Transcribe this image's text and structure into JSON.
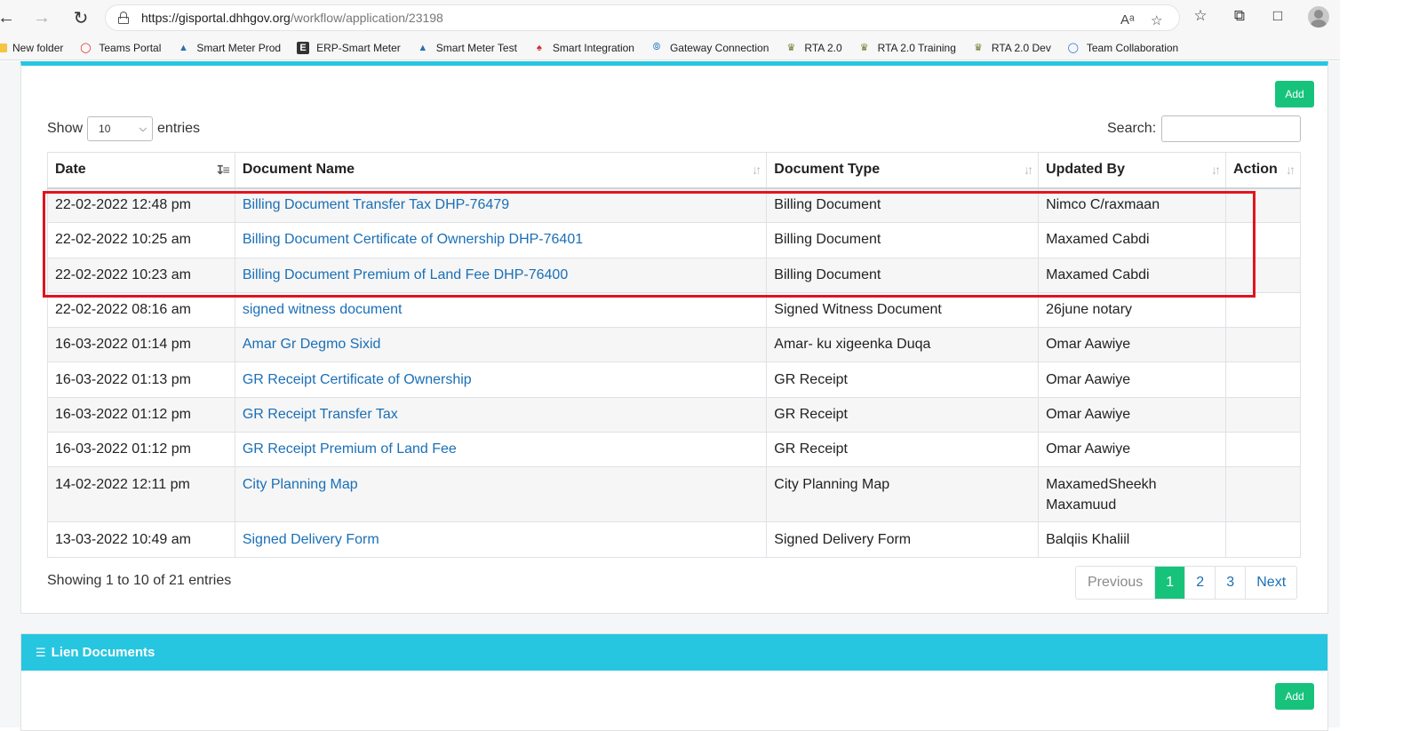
{
  "browser": {
    "url_host": "https://gisportal.dhhgov.org",
    "url_path": "/workflow/application/23198",
    "bookmarks": [
      {
        "label": "New folder",
        "icon": "folder-icon"
      },
      {
        "label": "Teams Portal",
        "icon": "teams-portal-icon"
      },
      {
        "label": "Smart Meter Prod",
        "icon": "water-drop-icon"
      },
      {
        "label": "ERP-Smart Meter",
        "icon": "e-letter-icon"
      },
      {
        "label": "Smart Meter Test",
        "icon": "water-drop-icon"
      },
      {
        "label": "Smart Integration",
        "icon": "crown-icon"
      },
      {
        "label": "Gateway Connection",
        "icon": "gateway-icon"
      },
      {
        "label": "RTA 2.0",
        "icon": "crest-icon"
      },
      {
        "label": "RTA 2.0 Training",
        "icon": "crest-icon"
      },
      {
        "label": "RTA 2.0 Dev",
        "icon": "crest-icon"
      },
      {
        "label": "Team Collaboration",
        "icon": "collab-icon"
      }
    ]
  },
  "documents": {
    "add_label": "Add",
    "show_label": "Show",
    "entries_label": "entries",
    "page_length": "10",
    "search_label": "Search:",
    "columns": [
      "Date",
      "Document Name",
      "Document Type",
      "Updated By",
      "Action"
    ],
    "rows": [
      {
        "date": "22-02-2022 12:48 pm",
        "name": "Billing Document Transfer Tax DHP-76479",
        "type": "Billing Document",
        "updated_by": "Nimco C/raxmaan"
      },
      {
        "date": "22-02-2022 10:25 am",
        "name": "Billing Document Certificate of Ownership DHP-76401",
        "type": "Billing Document",
        "updated_by": "Maxamed Cabdi"
      },
      {
        "date": "22-02-2022 10:23 am",
        "name": "Billing Document Premium of Land Fee DHP-76400",
        "type": "Billing Document",
        "updated_by": "Maxamed Cabdi"
      },
      {
        "date": "22-02-2022 08:16 am",
        "name": "signed witness document",
        "type": "Signed Witness Document",
        "updated_by": "26june notary"
      },
      {
        "date": "16-03-2022 01:14 pm",
        "name": "Amar Gr Degmo Sixid",
        "type": "Amar- ku xigeenka Duqa",
        "updated_by": "Omar Aawiye"
      },
      {
        "date": "16-03-2022 01:13 pm",
        "name": "GR Receipt Certificate of Ownership",
        "type": "GR Receipt",
        "updated_by": "Omar Aawiye"
      },
      {
        "date": "16-03-2022 01:12 pm",
        "name": "GR Receipt Transfer Tax",
        "type": "GR Receipt",
        "updated_by": "Omar Aawiye"
      },
      {
        "date": "16-03-2022 01:12 pm",
        "name": "GR Receipt Premium of Land Fee",
        "type": "GR Receipt",
        "updated_by": "Omar Aawiye"
      },
      {
        "date": "14-02-2022 12:11 pm",
        "name": "City Planning Map",
        "type": "City Planning Map",
        "updated_by": "MaxamedSheekh Maxamuud"
      },
      {
        "date": "13-03-2022 10:49 am",
        "name": "Signed Delivery Form",
        "type": "Signed Delivery Form",
        "updated_by": "Balqiis Khaliil"
      }
    ],
    "info": "Showing 1 to 10 of 21 entries",
    "pagination": {
      "previous": "Previous",
      "pages": [
        "1",
        "2",
        "3"
      ],
      "current": "1",
      "next": "Next"
    }
  },
  "lien_documents": {
    "title": "Lien Documents",
    "add_label": "Add"
  },
  "colors": {
    "accent": "#26c6e0",
    "add_button": "#17c37b",
    "link": "#1a6fb6",
    "highlight_box": "#e0141e"
  }
}
